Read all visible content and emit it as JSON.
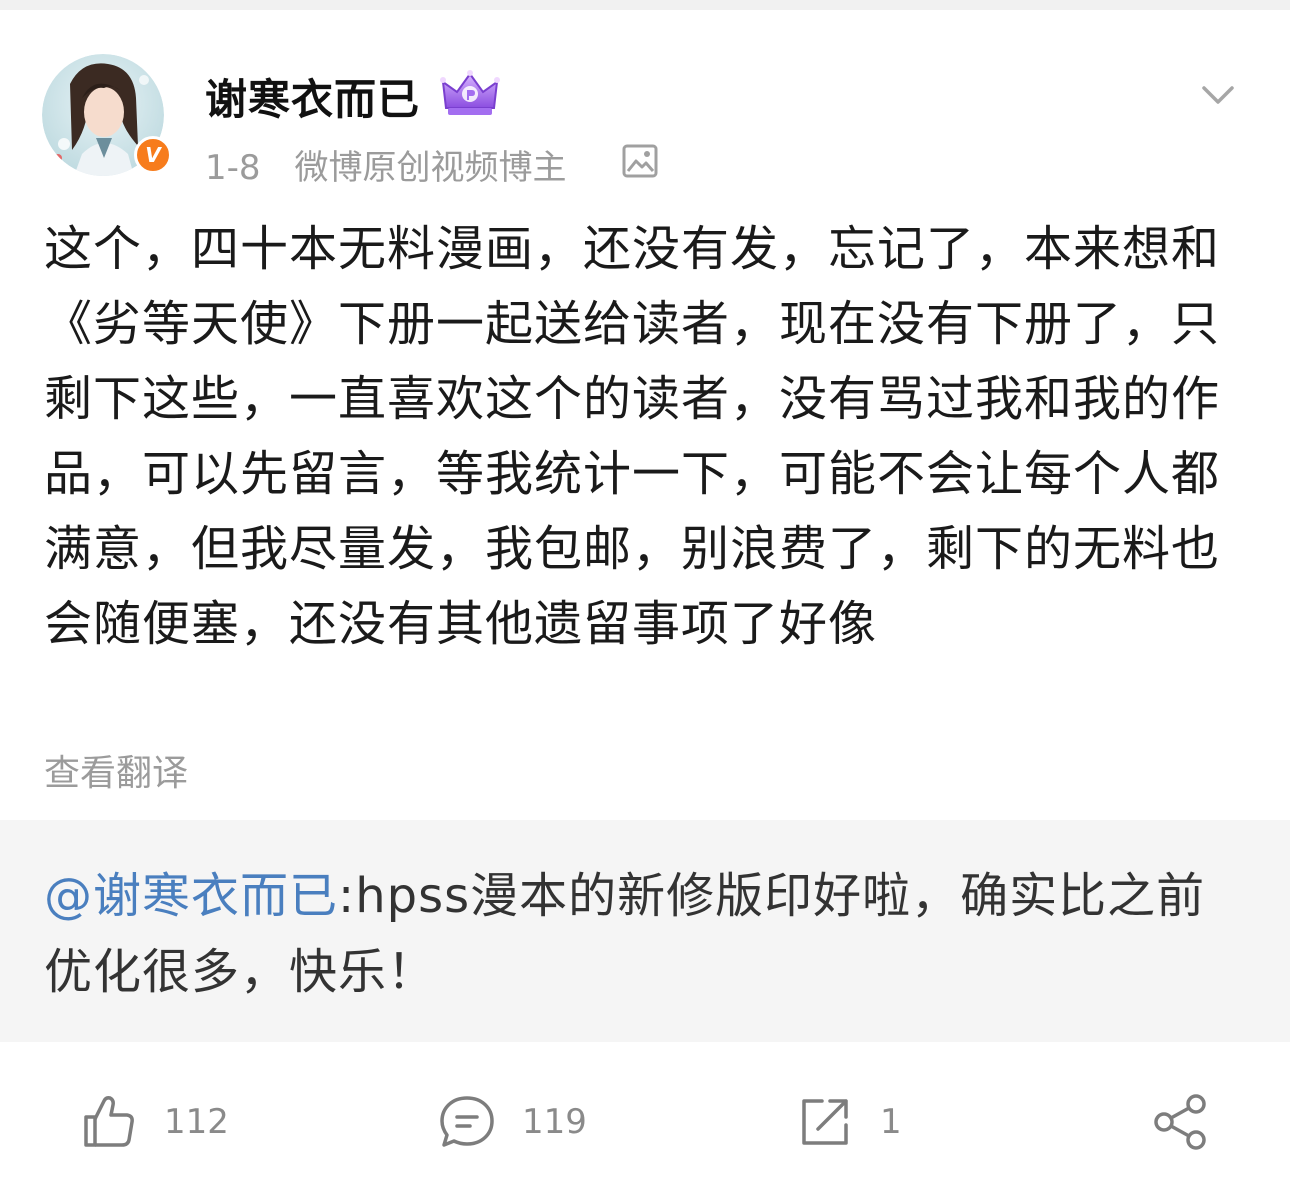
{
  "post": {
    "author": "谢寒衣而已",
    "date": "1-8",
    "author_title": "微博原创视频博主",
    "verified_badge": "V",
    "text": "这个，四十本无料漫画，还没有发，忘记了，本来想和《劣等天使》下册一起送给读者，现在没有下册了，只剩下这些，一直喜欢这个的读者，没有骂过我和我的作品，可以先留言，等我统计一下，可能不会让每个人都满意，但我尽量发，我包邮，别浪费了，剩下的无料也会随便塞，还没有其他遗留事项了好像",
    "translate_label": "查看翻译"
  },
  "repost": {
    "mention": "@谢寒衣而已",
    "text": ":hpss漫本的新修版印好啦，确实比之前优化很多，快乐！"
  },
  "actions": {
    "like_count": "112",
    "comment_count": "119",
    "repost_count": "1"
  },
  "icons": {
    "menu": "chevron-down-icon",
    "image": "image-icon",
    "crown": "crown-icon",
    "like": "thumbs-up-icon",
    "comment": "comment-icon",
    "repost": "repost-icon",
    "share": "share-icon"
  },
  "colors": {
    "mention_link": "#4a7fbf",
    "verified_badge": "#f77c1c",
    "muted_text": "#9b9b9b",
    "repost_bg": "#f5f5f5"
  }
}
